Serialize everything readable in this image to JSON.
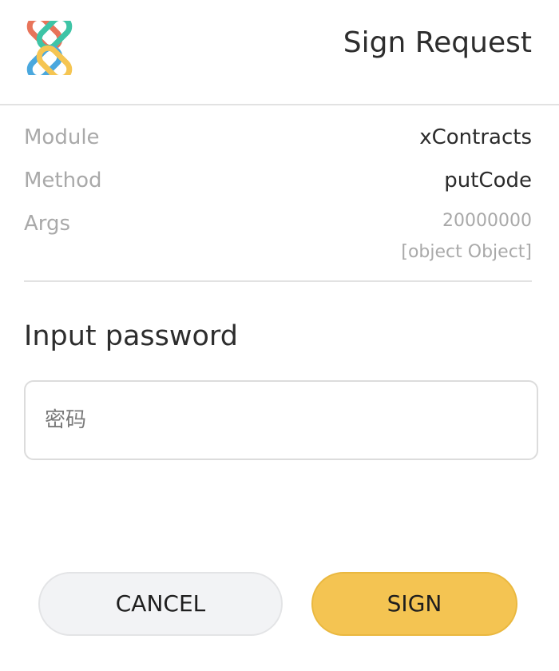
{
  "header": {
    "title": "Sign Request",
    "logo_icon": "chain-link-logo-icon",
    "logo_colors": [
      "#e8745a",
      "#3ec4a6",
      "#4aa8de",
      "#f5c552"
    ]
  },
  "details": {
    "rows": [
      {
        "label": "Module",
        "value": "xContracts"
      },
      {
        "label": "Method",
        "value": "putCode"
      }
    ],
    "args": {
      "label": "Args",
      "values": [
        "20000000",
        "[object Object]"
      ]
    }
  },
  "password": {
    "label": "Input password",
    "placeholder": "密码",
    "value": ""
  },
  "actions": {
    "cancel_label": "CANCEL",
    "sign_label": "SIGN",
    "sign_color": "#f4c452",
    "cancel_color": "#f2f3f5"
  }
}
